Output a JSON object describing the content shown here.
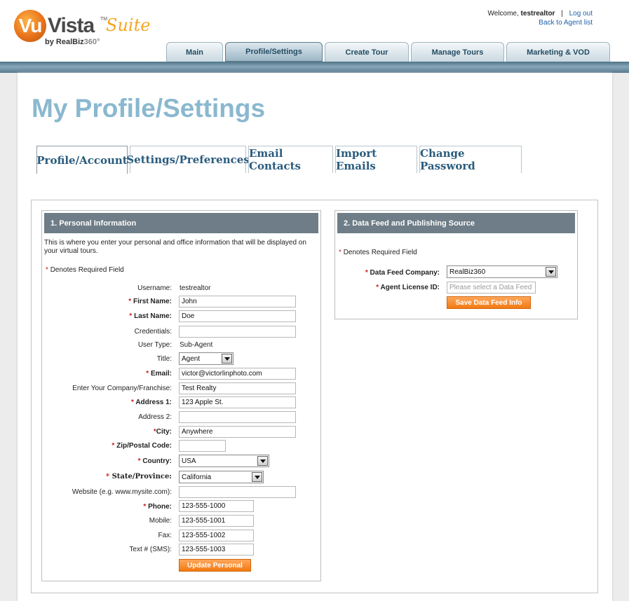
{
  "brand": {
    "vu": "Vu",
    "vista": "Vista",
    "tm": "TM",
    "suite": "Suite",
    "byline_prefix": "by RealBiz",
    "byline_suffix": "360°"
  },
  "header": {
    "welcome_prefix": "Welcome,",
    "username": "testrealtor",
    "separator": "|",
    "logout_label": "Log out",
    "back_label": "Back to Agent list"
  },
  "main_nav": {
    "tabs": [
      {
        "label": "Main"
      },
      {
        "label": "Profile/Settings"
      },
      {
        "label": "Create Tour"
      },
      {
        "label": "Manage Tours"
      },
      {
        "label": "Marketing & VOD"
      }
    ],
    "active": "Profile/Settings"
  },
  "page": {
    "title": "My Profile/Settings"
  },
  "sub_tabs": {
    "tabs": [
      {
        "label": "Profile/Account"
      },
      {
        "label": "Settings/Preferences"
      },
      {
        "label": "Email Contacts"
      },
      {
        "label": "Import Emails"
      },
      {
        "label": "Change Password"
      }
    ],
    "active": "Profile/Account"
  },
  "personal": {
    "heading": "1. Personal Information",
    "intro": "This is where you enter your personal and office information that will be displayed on your virtual tours.",
    "required_star": "*",
    "required_note": "Denotes Required Field",
    "username_label": "Username:",
    "username_value": "testrealtor",
    "first_name_label": "First Name:",
    "first_name_value": "John",
    "last_name_label": "Last Name:",
    "last_name_value": "Doe",
    "credentials_label": "Credentials:",
    "credentials_value": "",
    "user_type_label": "User Type:",
    "user_type_value": "Sub-Agent",
    "title_label": "Title:",
    "title_value": "Agent",
    "email_label": "Email:",
    "email_value": "victor@victorlinphoto.com",
    "company_label": "Enter Your Company/Franchise:",
    "company_value": "Test Realty",
    "address1_label": "Address 1:",
    "address1_value": "123 Apple St.",
    "address2_label": "Address 2:",
    "address2_value": "",
    "city_label": "City:",
    "city_value": "Anywhere",
    "zip_label": "Zip/Postal Code:",
    "zip_value": "",
    "country_label": "Country:",
    "country_value": "USA",
    "state_label": "State/Province:",
    "state_value": "California",
    "website_label": "Website (e.g. www.mysite.com):",
    "website_value": "",
    "phone_label": "Phone:",
    "phone_value": "123-555-1000",
    "mobile_label": "Mobile:",
    "mobile_value": "123-555-1001",
    "fax_label": "Fax:",
    "fax_value": "123-555-1002",
    "sms_label": "Text # (SMS):",
    "sms_value": "123-555-1003",
    "update_button": "Update Personal"
  },
  "datafeed": {
    "heading": "2. Data Feed and Publishing Source",
    "required_star": "*",
    "required_note": "Denotes Required Field",
    "company_label": "Data Feed Company:",
    "company_value": "RealBiz360",
    "license_label": "Agent License ID:",
    "license_placeholder": "Please select a Data Feed",
    "save_button": "Save Data Feed Info"
  },
  "colors": {
    "accent_orange": "#f27a12",
    "section_header": "#6e7d87",
    "title_blue": "#8ab8cf",
    "required_red": "#c81d1d"
  },
  "icons": {
    "select_arrow": "chevron-down-icon"
  }
}
